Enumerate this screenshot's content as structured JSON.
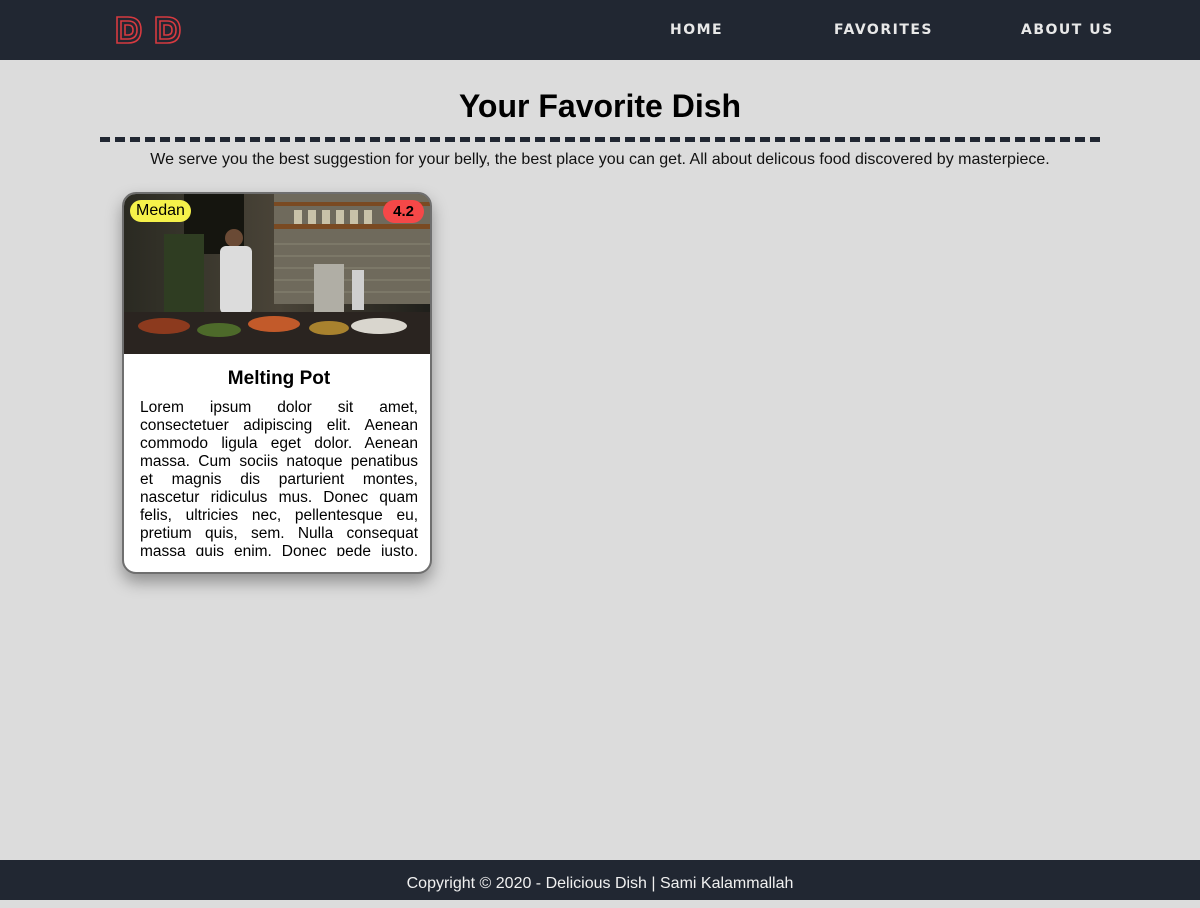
{
  "nav": {
    "logo_text": "DD",
    "links": [
      "HOME",
      "FAVORITES",
      "ABOUT US"
    ]
  },
  "header": {
    "title": "Your Favorite Dish",
    "tagline": "We serve you the best suggestion for your belly, the best place you can get. All about delicous food discovered by masterpiece."
  },
  "card": {
    "city": "Medan",
    "rating": "4.2",
    "name": "Melting Pot",
    "description": "Lorem ipsum dolor sit amet, consectetuer adipiscing elit. Aenean commodo ligula eget dolor. Aenean massa. Cum sociis natoque penatibus et magnis dis parturient montes, nascetur ridiculus mus. Donec quam felis, ultricies nec, pellentesque eu, pretium quis, sem. Nulla consequat massa quis enim. Donec pede justo, fringilla vel, aliquet nec, vulputate eget, arcu."
  },
  "footer": {
    "text": "Copyright © 2020 - Delicious Dish | Sami Kalammallah"
  },
  "colors": {
    "navbar": "#212732",
    "logo": "#d63a40",
    "background": "#dcdcdc",
    "city_badge": "#f5f14a",
    "rating_badge": "#f54848"
  }
}
